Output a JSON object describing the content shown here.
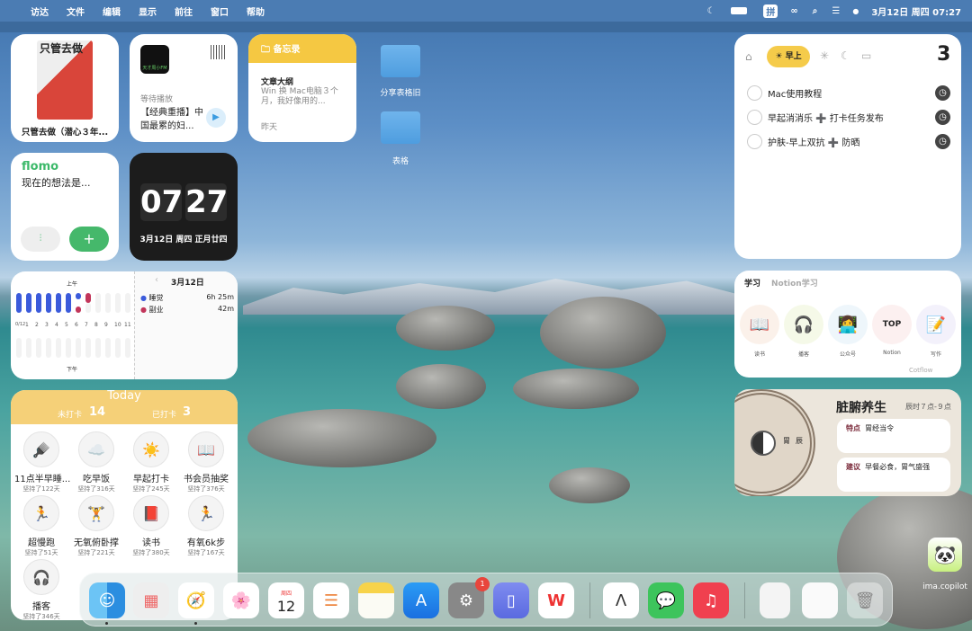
{
  "menubar": {
    "items": [
      "访达",
      "文件",
      "编辑",
      "显示",
      "前往",
      "窗口",
      "帮助"
    ],
    "input_method": "拼",
    "datetime": "3月12日 周四 07:27"
  },
  "book": {
    "cover_title": "只管去做",
    "title": "只管去做（潜心３年..."
  },
  "podcast": {
    "cover": "天才周小FM",
    "status": "等待播放",
    "title": "【经典重播】中国最累的妇..."
  },
  "notes": {
    "app": "备忘录",
    "title": "文章大纲",
    "preview": "Win 换 Mac电脑３个月，我好像用的...",
    "date": "昨天"
  },
  "folders": [
    {
      "label": "分享表格旧"
    },
    {
      "label": "表格"
    }
  ],
  "flomo": {
    "brand": "flomo",
    "prompt": "现在的想法是..."
  },
  "clock": {
    "hour": "07",
    "minute": "27",
    "date": "3月12日 周四 正月廿四"
  },
  "timeline": {
    "am_label": "上午",
    "pm_label": "下午",
    "hours": [
      "0/12",
      "1",
      "2",
      "3",
      "4",
      "5",
      "6",
      "7",
      "8",
      "9",
      "10",
      "11"
    ],
    "date": "3月12日",
    "entries": [
      {
        "name": "睡觉",
        "duration": "6h 25m",
        "color": "#3b5bdb"
      },
      {
        "name": "副业",
        "duration": "42m",
        "color": "#c2355a"
      }
    ]
  },
  "habits": {
    "title": "Today",
    "pending_label": "未打卡",
    "pending": "14",
    "done_label": "已打卡",
    "done": "3",
    "items": [
      {
        "name": "11点半早睡...",
        "streak": "坚持了122天",
        "icon": "🪮"
      },
      {
        "name": "吃早饭",
        "streak": "坚持了316天",
        "icon": "☁️"
      },
      {
        "name": "早起打卡",
        "streak": "坚持了245天",
        "icon": "☀️"
      },
      {
        "name": "书会员抽奖",
        "streak": "坚持了376天",
        "icon": "📖"
      },
      {
        "name": "超慢跑",
        "streak": "坚持了51天",
        "icon": "🏃"
      },
      {
        "name": "无氧俯卧撑",
        "streak": "坚持了221天",
        "icon": "🏋️"
      },
      {
        "name": "读书",
        "streak": "坚持了380天",
        "icon": "📕"
      },
      {
        "name": "有氧6k步",
        "streak": "坚持了167天",
        "icon": "🏃"
      },
      {
        "name": "播客",
        "streak": "坚持了346天",
        "icon": "🎧"
      }
    ]
  },
  "todo": {
    "tab_active": "早上",
    "count": "3",
    "items": [
      "Mac使用教程",
      "早起消消乐 ➕ 打卡任务发布",
      "护肤-早上双抗 ➕ 防晒"
    ]
  },
  "learning": {
    "tabs": [
      "学习",
      "Notion学习"
    ],
    "items": [
      {
        "label": "读书",
        "icon": "📖"
      },
      {
        "label": "播客",
        "icon": "🎧"
      },
      {
        "label": "公众号",
        "icon": "👩‍💻"
      },
      {
        "label": "Notion",
        "icon": "TOP"
      },
      {
        "label": "写作",
        "icon": "📝"
      }
    ],
    "brand": "Cotflow"
  },
  "organ": {
    "title": "脏腑养生",
    "time": "辰时７点-９点",
    "wheel": [
      "胃",
      "辰"
    ],
    "feature_label": "特点",
    "feature": "胃经当令",
    "advice_label": "建议",
    "advice": "早餐必食，胃气盛强"
  },
  "desktop_app": {
    "label": "ima.copilot"
  },
  "dock": {
    "calendar_weekday": "周四",
    "calendar_day": "12",
    "settings_badge": "1",
    "apps": [
      "finder",
      "launchpad",
      "safari",
      "photos",
      "calendar",
      "reminders",
      "notes",
      "app-store",
      "system-settings",
      "simulator",
      "wps",
      "cotflow",
      "wechat",
      "music",
      "recent-doc-1",
      "recent-doc-2",
      "trash"
    ]
  }
}
